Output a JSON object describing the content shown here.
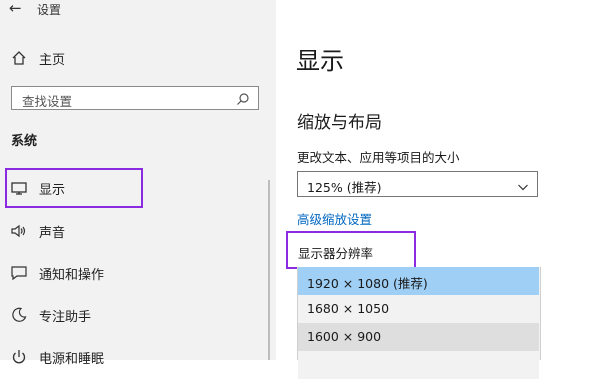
{
  "window": {
    "title": "设置"
  },
  "sidebar": {
    "home_label": "主页",
    "search_placeholder": "查找设置",
    "section_label": "系统",
    "items": [
      {
        "label": "显示",
        "icon": "monitor-icon"
      },
      {
        "label": "声音",
        "icon": "speaker-icon"
      },
      {
        "label": "通知和操作",
        "icon": "notification-icon"
      },
      {
        "label": "专注助手",
        "icon": "moon-icon"
      },
      {
        "label": "电源和睡眠",
        "icon": "power-icon"
      }
    ]
  },
  "main": {
    "title": "显示",
    "scale_layout_heading": "缩放与布局",
    "scale_label": "更改文本、应用等项目的大小",
    "scale_value": "125% (推荐)",
    "advanced_scaling_link": "高级缩放设置",
    "resolution_label": "显示器分辨率",
    "resolution_options": [
      "1920 × 1080 (推荐)",
      "1680 × 1050",
      "1600 × 900"
    ],
    "selected_option": "1920 × 1080 (推荐)"
  },
  "colors": {
    "highlight_border": "#8a2be2",
    "selected_option_bg": "#9fcff5",
    "link": "#0067c0"
  }
}
